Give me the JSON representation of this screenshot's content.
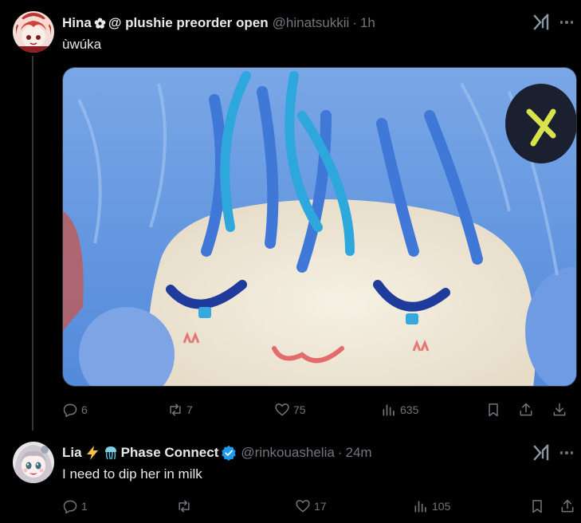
{
  "tweets": [
    {
      "name": "Hina",
      "name_suffix": "@ plushie preorder open",
      "handle": "@hinatsukkii",
      "time": "1h",
      "text": "ùwúka",
      "stats": {
        "replies": "6",
        "reposts": "7",
        "likes": "75",
        "views": "635"
      }
    },
    {
      "name": "Lia",
      "name_suffix": "Phase Connect",
      "handle": "@rinkouashelia",
      "time": "24m",
      "text": "I need to dip her in milk",
      "stats": {
        "replies": "1",
        "reposts": "",
        "likes": "17",
        "views": "105"
      }
    }
  ],
  "separator": "·",
  "icons": {
    "flower": "flower-icon",
    "lightning": "lightning-icon",
    "jellyfish": "jellyfish-icon",
    "verified": "verified-badge-icon",
    "grok": "grok-icon",
    "more": "more-icon",
    "reply": "reply-icon",
    "repost": "repost-icon",
    "like": "like-icon",
    "views": "views-icon",
    "bookmark": "bookmark-icon",
    "share": "share-icon",
    "download": "download-icon"
  },
  "colors": {
    "background": "#000000",
    "text": "#e7e9ea",
    "muted": "#71767b",
    "verified": "#1d9bf0",
    "thread_line": "#333639"
  }
}
